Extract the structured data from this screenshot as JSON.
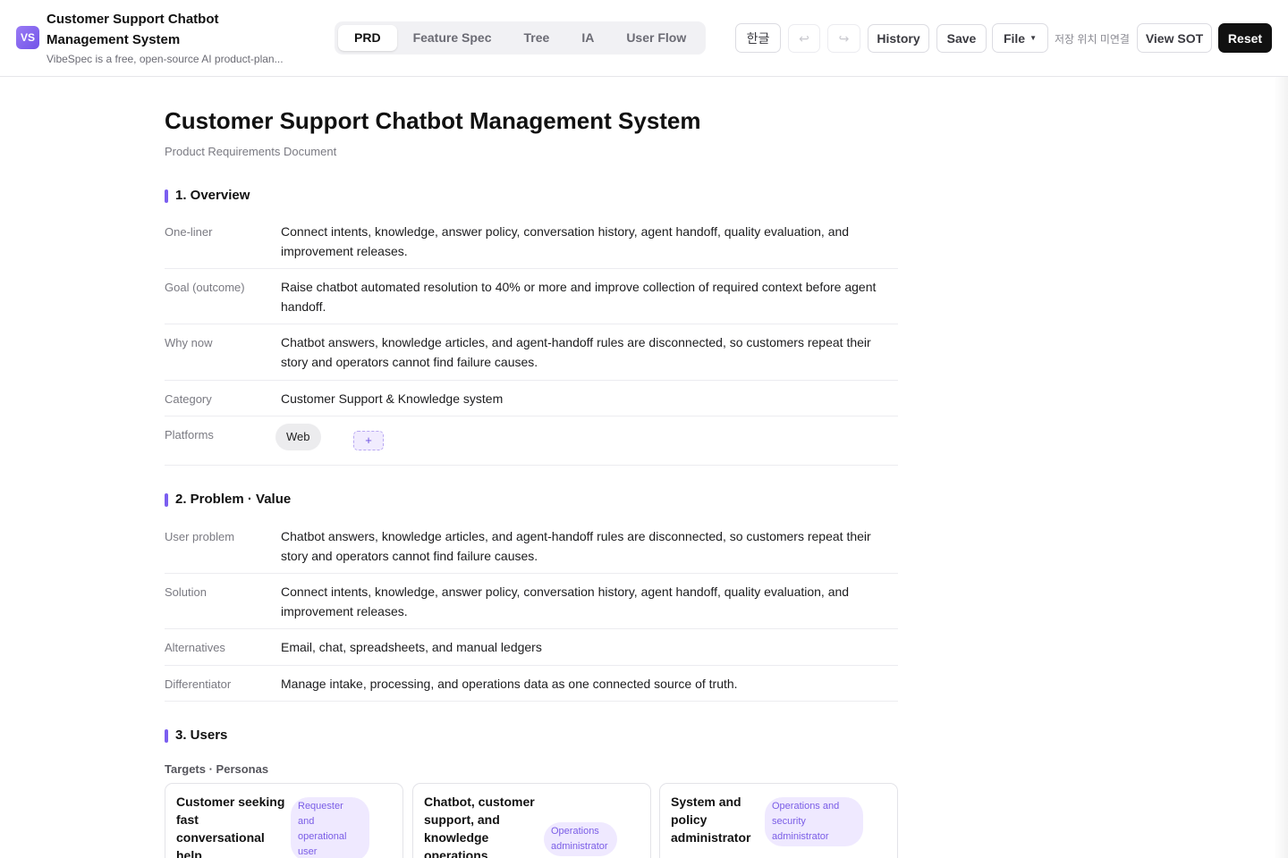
{
  "app": {
    "logo": "VS",
    "title": "Customer Support Chatbot Management System",
    "subtitle": "VibeSpec is a free, open-source AI product-plan..."
  },
  "tabs": [
    "PRD",
    "Feature Spec",
    "Tree",
    "IA",
    "User Flow"
  ],
  "active_tab": "PRD",
  "toolbar": {
    "lang": "한글",
    "undo": "↩",
    "redo": "↪",
    "history": "History",
    "save": "Save",
    "file": "File",
    "storage_status": "저장 위치 미연결",
    "view_sot": "View SOT",
    "reset": "Reset"
  },
  "doc": {
    "title": "Customer Support Chatbot Management System",
    "subtitle": "Product Requirements Document",
    "overview": {
      "heading": "1. Overview",
      "one_liner_label": "One-liner",
      "one_liner": "Connect intents, knowledge, answer policy, conversation history, agent handoff, quality evaluation, and improvement releases.",
      "goal_label": "Goal (outcome)",
      "goal": "Raise chatbot automated resolution to 40% or more and improve collection of required context before agent handoff.",
      "why_label": "Why now",
      "why": "Chatbot answers, knowledge articles, and agent-handoff rules are disconnected, so customers repeat their story and operators cannot find failure causes.",
      "category_label": "Category",
      "category": "Customer Support & Knowledge system",
      "platforms_label": "Platforms",
      "platforms": [
        "Web"
      ],
      "add_platform": "+"
    },
    "problem": {
      "heading": "2. Problem · Value",
      "user_problem_label": "User problem",
      "user_problem": "Chatbot answers, knowledge articles, and agent-handoff rules are disconnected, so customers repeat their story and operators cannot find failure causes.",
      "solution_label": "Solution",
      "solution": "Connect intents, knowledge, answer policy, conversation history, agent handoff, quality evaluation, and improvement releases.",
      "alternatives_label": "Alternatives",
      "alternatives": "Email, chat, spreadsheets, and manual ledgers",
      "differentiator_label": "Differentiator",
      "differentiator": "Manage intake, processing, and operations data as one connected source of truth."
    },
    "users": {
      "heading": "3. Users",
      "subheading": "Targets · Personas",
      "personas": [
        {
          "name": "Customer seeking fast conversational help",
          "role": "Requester and operational user"
        },
        {
          "name": "Chatbot, customer support, and knowledge operations",
          "role": "Operations administrator"
        },
        {
          "name": "System and policy administrator",
          "role": "Operations and security administrator"
        }
      ]
    }
  }
}
